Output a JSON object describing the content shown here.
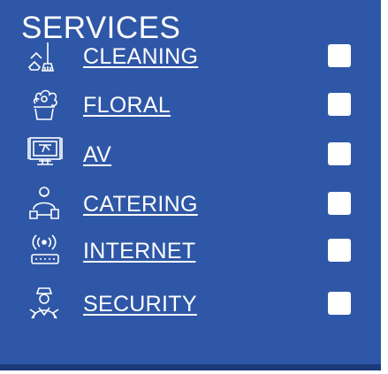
{
  "header": {
    "title": "SERVICES"
  },
  "services": [
    {
      "label": "CLEANING",
      "icon": "cleaning-icon",
      "checked": false
    },
    {
      "label": "FLORAL",
      "icon": "floral-icon",
      "checked": false
    },
    {
      "label": "AV",
      "icon": "av-icon",
      "checked": false
    },
    {
      "label": "CATERING",
      "icon": "catering-icon",
      "checked": false
    },
    {
      "label": "INTERNET",
      "icon": "internet-icon",
      "checked": false
    },
    {
      "label": "SECURITY",
      "icon": "security-icon",
      "checked": false
    }
  ],
  "colors": {
    "panel": "#2f57a7",
    "border": "#1a3a7a",
    "text": "#ffffff",
    "checkbox": "#ffffff"
  }
}
